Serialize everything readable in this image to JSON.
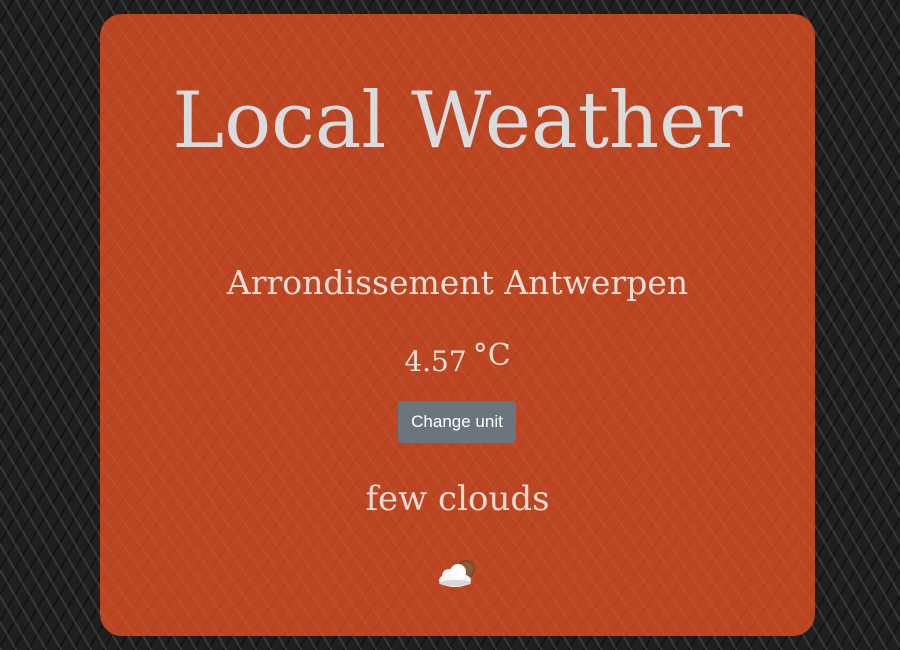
{
  "app": {
    "title": "Local Weather"
  },
  "weather": {
    "location": "Arrondissement Antwerpen",
    "temperature": "4.57",
    "unit": "°C",
    "description": "few clouds",
    "icon": "few-clouds-day-icon"
  },
  "controls": {
    "change_unit_label": "Change unit"
  },
  "colors": {
    "background": "#1f1f1f",
    "card": "#bc4522",
    "button": "#6c757d",
    "title_text": "#d9dbdd"
  }
}
